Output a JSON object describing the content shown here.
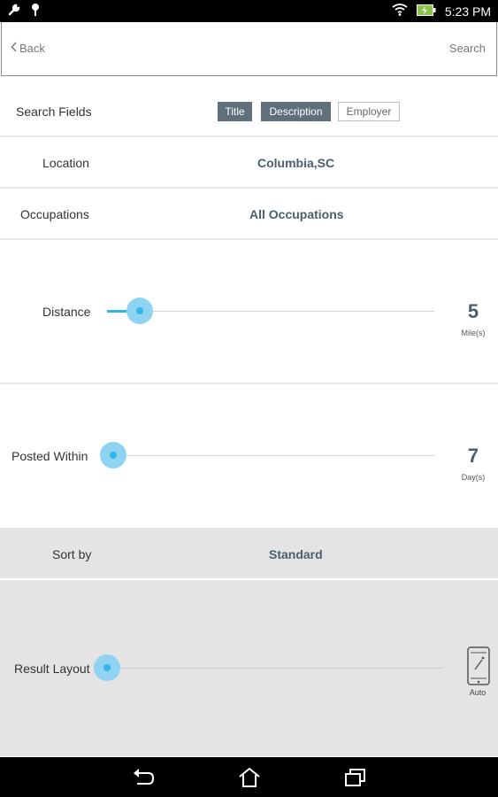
{
  "status_bar": {
    "time": "5:23 PM"
  },
  "header": {
    "back_label": "Back",
    "search_label": "Search"
  },
  "search_fields": {
    "label": "Search Fields",
    "chips": [
      {
        "label": "Title",
        "selected": true
      },
      {
        "label": "Description",
        "selected": true
      },
      {
        "label": "Employer",
        "selected": false
      }
    ]
  },
  "location": {
    "label": "Location",
    "value": "Columbia,SC"
  },
  "occupations": {
    "label": "Occupations",
    "value": "All Occupations"
  },
  "distance": {
    "label": "Distance",
    "value": "5",
    "unit": "Mile(s)",
    "level": 0.02
  },
  "posted_within": {
    "label": "Posted Within",
    "value": "7",
    "unit": "Day(s)",
    "level": 0.0
  },
  "sort_by": {
    "label": "Sort by",
    "value": "Standard"
  },
  "result_layout": {
    "label": "Result Layout",
    "mode": "Auto",
    "level": 0.0
  },
  "icons": [
    "wrench-icon",
    "location-pin-icon",
    "wifi-icon",
    "battery-icon",
    "chevron-left-icon",
    "phone-wand-icon",
    "back-nav-icon",
    "home-nav-icon",
    "recents-nav-icon"
  ],
  "colors": {
    "accent": "#33b5e5",
    "thumb": "#8fd3f2",
    "chip_selected": "#5f707a",
    "value_text": "#4b5f6b",
    "gray_section": "#e4e4e4"
  }
}
